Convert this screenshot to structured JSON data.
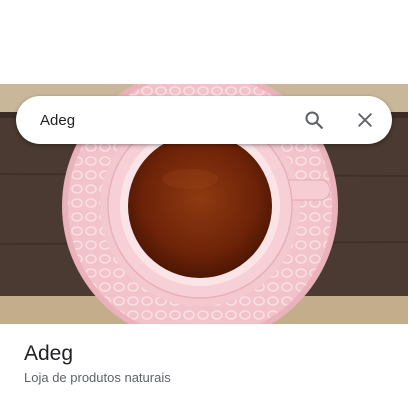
{
  "search": {
    "value": "Adeg",
    "placeholder": ""
  },
  "icons": {
    "search": "search-icon",
    "close": "close-icon"
  },
  "place": {
    "name": "Adeg",
    "category": "Loja de produtos naturais"
  },
  "colors": {
    "text_primary": "#202124",
    "text_secondary": "#5f6368",
    "icon": "#5f6368",
    "saucer_pink": "#f2c3ca",
    "tea": "#7a2a08",
    "table_wood": "#4a3a31"
  }
}
